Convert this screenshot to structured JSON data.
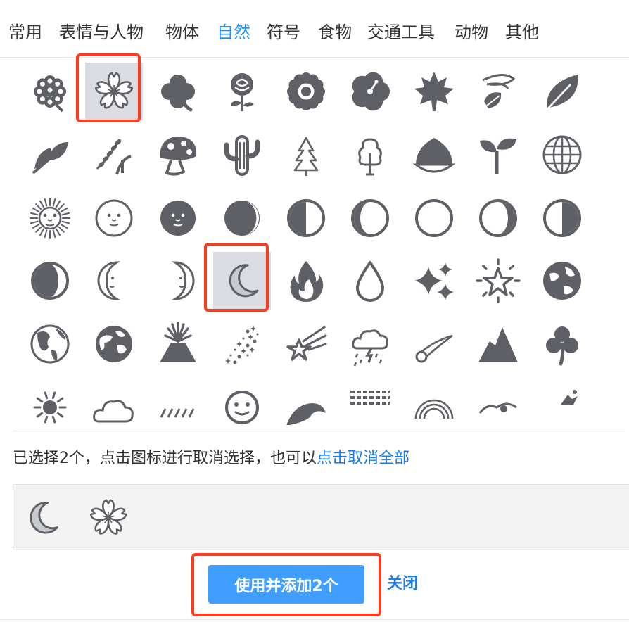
{
  "tabs": [
    {
      "label": "常用",
      "active": false
    },
    {
      "label": "表情与人物",
      "active": false
    },
    {
      "label": "物体",
      "active": false
    },
    {
      "label": "自然",
      "active": true
    },
    {
      "label": "符号",
      "active": false
    },
    {
      "label": "食物",
      "active": false
    },
    {
      "label": "交通工具",
      "active": false
    },
    {
      "label": "动物",
      "active": false
    },
    {
      "label": "其他",
      "active": false
    }
  ],
  "icon_color": "#5f6066",
  "accent_color": "#409eff",
  "highlight_color": "#ff3b1f",
  "icons": [
    [
      "hydrangea-icon",
      "cherry-blossom-icon",
      "four-leaf-clover-icon",
      "rose-icon",
      "sunflower-icon",
      "hibiscus-icon",
      "maple-leaf-icon",
      "leaf-in-wind-icon",
      "fallen-leaf-icon"
    ],
    [
      "herb-icon",
      "rice-ear-icon",
      "mushroom-icon",
      "cactus-icon",
      "evergreen-tree-icon",
      "deciduous-tree-icon",
      "chestnut-icon",
      "seedling-icon",
      "globe-meridians-icon"
    ],
    [
      "sun-with-face-icon",
      "full-moon-face-icon",
      "new-moon-face-icon",
      "waxing-crescent-moon-icon",
      "first-quarter-moon-icon",
      "waxing-gibbous-moon-icon",
      "full-moon-icon",
      "waning-gibbous-moon-icon",
      "last-quarter-moon-icon"
    ],
    [
      "waning-crescent-moon-icon",
      "first-quarter-moon-face-icon",
      "last-quarter-moon-face-icon",
      "crescent-moon-icon",
      "fire-icon",
      "droplet-icon",
      "sparkles-icon",
      "dizzy-star-icon",
      "globe-icon"
    ],
    [
      "earth-americas-icon",
      "earth-asia-icon",
      "volcano-icon",
      "milky-way-icon",
      "shooting-star-icon",
      "storm-cloud-icon",
      "comet-icon",
      "mountain-icon",
      "shamrock-icon"
    ],
    [
      "sun-behind-cloud-icon",
      "cloud-icon",
      "rain-icon",
      "smiling-face-icon",
      "wave-icon",
      "fog-icon",
      "rainbow-icon",
      "wind-face-icon",
      "island-icon"
    ]
  ],
  "selected_cells": [
    [
      0,
      1
    ],
    [
      3,
      3
    ]
  ],
  "info": {
    "text": "已选择2个，点击图标进行取消选择，也可以",
    "link": "点击取消全部"
  },
  "selected_items": [
    "crescent-moon-icon",
    "cherry-blossom-icon"
  ],
  "actions": {
    "confirm_label": "使用并添加2个",
    "close_label": "关闭"
  }
}
